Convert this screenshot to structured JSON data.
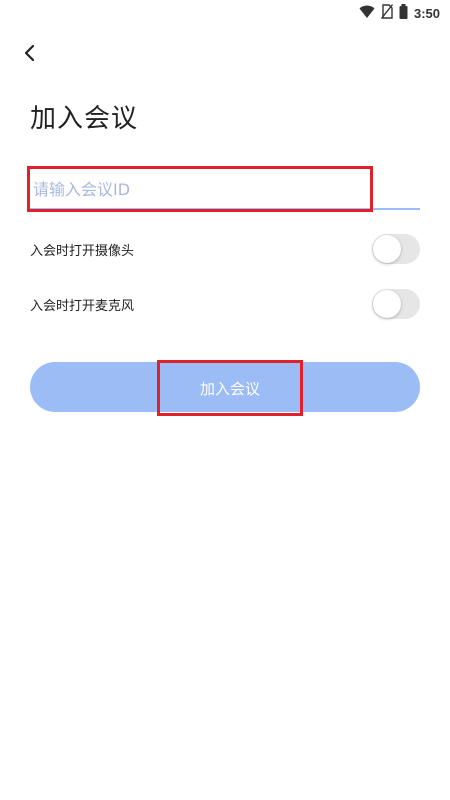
{
  "status_bar": {
    "time": "3:50",
    "icons": [
      "wifi-icon",
      "no-sim-icon",
      "battery-icon"
    ]
  },
  "header": {
    "back_icon": "chevron-left-icon",
    "title": "加入会议"
  },
  "form": {
    "meeting_id": {
      "value": "",
      "placeholder": "请输入会议ID"
    },
    "camera_toggle": {
      "label": "入会时打开摄像头",
      "on": false
    },
    "mic_toggle": {
      "label": "入会时打开麦克风",
      "on": false
    },
    "join_button": {
      "label": "加入会议"
    }
  },
  "colors": {
    "accent": "#9bbcf5",
    "highlight": "#e0202b",
    "toggle_off": "#e6e6e6",
    "text": "#222222"
  }
}
